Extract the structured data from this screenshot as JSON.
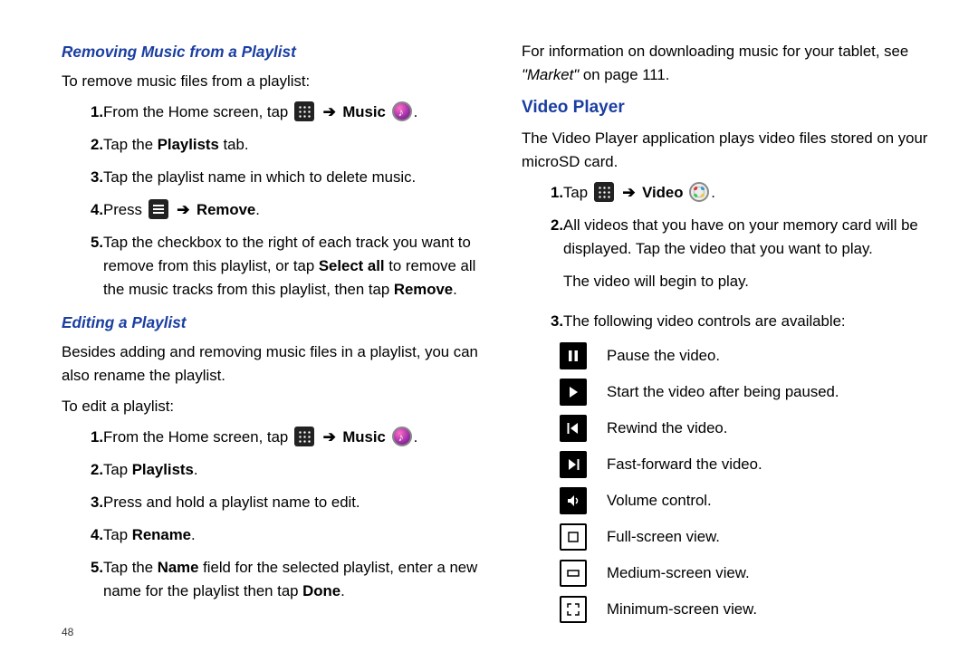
{
  "left": {
    "removing": {
      "heading": "Removing Music from a Playlist",
      "intro": "To remove music files from a playlist:",
      "step1_a": "From the Home screen, tap ",
      "step1_music": "Music",
      "step2_a": "Tap the ",
      "step2_b": "Playlists",
      "step2_c": " tab.",
      "step3": "Tap the playlist name in which to delete music.",
      "step4_a": "Press ",
      "step4_b": "Remove",
      "step5_a": "Tap the checkbox to the right of each track you want to remove from this playlist, or tap ",
      "step5_b": "Select all",
      "step5_c": " to remove all the music tracks from this playlist, then tap ",
      "step5_d": "Remove"
    },
    "editing": {
      "heading": "Editing a Playlist",
      "intro1": "Besides adding and removing music files in a playlist, you can also rename the playlist.",
      "intro2": "To edit a playlist:",
      "step1_a": "From the Home screen, tap ",
      "step1_music": "Music",
      "step2_a": "Tap ",
      "step2_b": "Playlists",
      "step3": "Press and hold a playlist name to edit.",
      "step4_a": "Tap ",
      "step4_b": "Rename",
      "step5_a": "Tap the ",
      "step5_b": "Name",
      "step5_c": " field for the selected playlist, enter a new name for the playlist then tap ",
      "step5_d": "Done"
    }
  },
  "right": {
    "download_a": "For information on downloading music for your tablet, see ",
    "download_b": "\"Market\"",
    "download_c": " on page 111.",
    "video_heading": "Video Player",
    "video_intro": "The Video Player application plays video files stored on your microSD card.",
    "step1_a": "Tap ",
    "step1_video": "Video",
    "step2": "All videos that you have on your memory card will be displayed. Tap the video that you want to play.",
    "step2b": "The video will begin to play.",
    "step3": "The following video controls are available:",
    "controls": {
      "pause": "Pause the video.",
      "play": "Start the video after being paused.",
      "rewind": "Rewind the video.",
      "ff": "Fast-forward the video.",
      "vol": "Volume control.",
      "full": "Full-screen view.",
      "med": "Medium-screen view.",
      "min": "Minimum-screen view."
    }
  },
  "page_number": "48",
  "nums": {
    "n1": "1.",
    "n2": "2.",
    "n3": "3.",
    "n4": "4.",
    "n5": "5."
  }
}
